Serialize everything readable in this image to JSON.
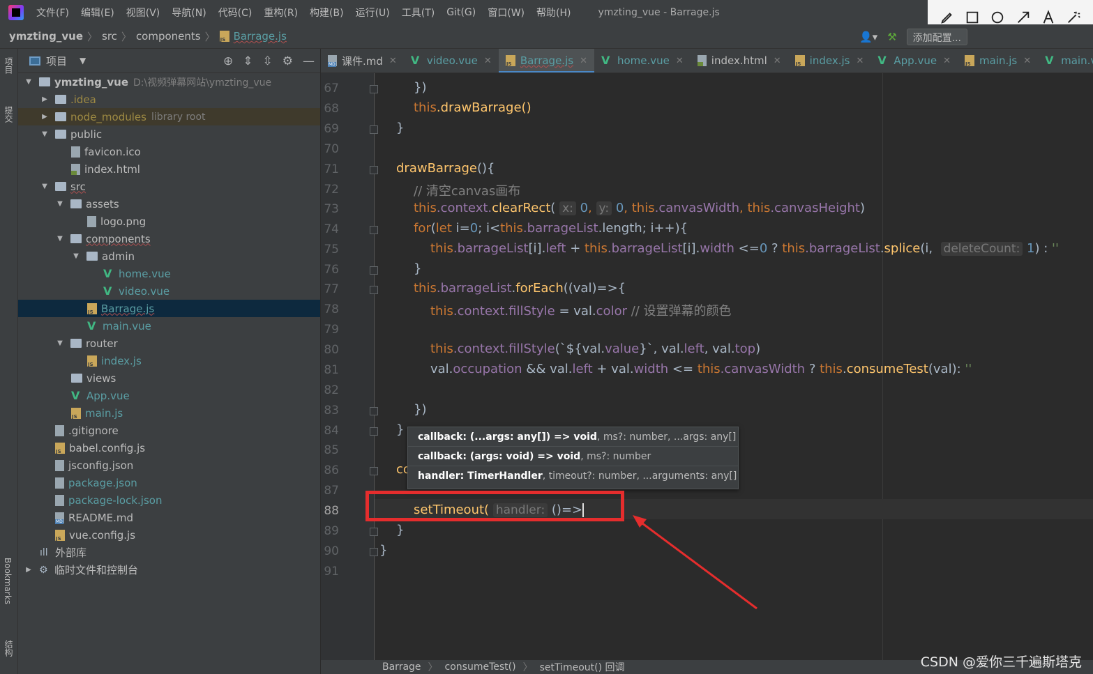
{
  "menu": {
    "items": [
      "文件(F)",
      "编辑(E)",
      "视图(V)",
      "导航(N)",
      "代码(C)",
      "重构(R)",
      "构建(B)",
      "运行(U)",
      "工具(T)",
      "Git(G)",
      "窗口(W)",
      "帮助(H)"
    ],
    "window_title": "ymzting_vue - Barrage.js"
  },
  "navbar": {
    "crumbs": [
      "ymzting_vue",
      "src",
      "components",
      "Barrage.js"
    ],
    "add_config": "添加配置..."
  },
  "left_strip": {
    "project": "项目",
    "commit": "提交",
    "bookmarks": "Bookmarks",
    "structure": "结构"
  },
  "project_panel": {
    "title": "项目",
    "tree": [
      {
        "name": "ymzting_vue",
        "path": "D:\\视频弹幕网站\\ymzting_vue"
      },
      {
        "name": ".idea"
      },
      {
        "name": "node_modules",
        "path": "library root"
      },
      {
        "name": "public"
      },
      {
        "name": "favicon.ico"
      },
      {
        "name": "index.html"
      },
      {
        "name": "src"
      },
      {
        "name": "assets"
      },
      {
        "name": "logo.png"
      },
      {
        "name": "components"
      },
      {
        "name": "admin"
      },
      {
        "name": "home.vue"
      },
      {
        "name": "video.vue"
      },
      {
        "name": "Barrage.js"
      },
      {
        "name": "main.vue"
      },
      {
        "name": "router"
      },
      {
        "name": "index.js"
      },
      {
        "name": "views"
      },
      {
        "name": "App.vue"
      },
      {
        "name": "main.js"
      },
      {
        "name": ".gitignore"
      },
      {
        "name": "babel.config.js"
      },
      {
        "name": "jsconfig.json"
      },
      {
        "name": "package.json"
      },
      {
        "name": "package-lock.json"
      },
      {
        "name": "README.md"
      },
      {
        "name": "vue.config.js"
      },
      {
        "name": "外部库"
      },
      {
        "name": "临时文件和控制台"
      }
    ]
  },
  "tabs": [
    "课件.md",
    "video.vue",
    "Barrage.js",
    "home.vue",
    "index.html",
    "index.js",
    "App.vue",
    "main.js",
    "main.vue"
  ],
  "editor": {
    "line_numbers": [
      "67",
      "68",
      "69",
      "70",
      "71",
      "72",
      "73",
      "74",
      "75",
      "76",
      "77",
      "78",
      "79",
      "80",
      "81",
      "82",
      "83",
      "84",
      "85",
      "86",
      "87",
      "88",
      "89",
      "90",
      "91"
    ],
    "code": {
      "l67": "})",
      "l68a": "this",
      "l68b": ".drawBarrage()",
      "l69": "}",
      "l71": "drawBarrage",
      "l71b": "(){",
      "l72": "// 清空canvas画布",
      "l73a": "this",
      "l73b": ".context.",
      "l73c": "clearRect",
      "l73d": "(",
      "l73hx": "x:",
      "l73e": "0",
      "l73f": ",",
      "l73hy": "y:",
      "l73g": "0",
      "l73h": ",",
      "l73i": "this",
      "l73j": ".canvasWidth",
      "l73k": ",",
      "l73l": "this",
      "l73m": ".canvasHeight",
      "l73n": ")",
      "l74a": "for",
      "l74b": "(",
      "l74c": "let",
      "l74d": " i=",
      "l74e": "0",
      "l74f": "; i<",
      "l74g": "this",
      "l74h": ".barrageList",
      "l74i": ".length; i++){",
      "l75a": "this",
      "l75b": ".barrageList",
      "l75c": "[i].",
      "l75d": "left",
      "l75e": " + ",
      "l75f": "this",
      "l75g": ".barrageList",
      "l75h": "[i].",
      "l75i": "width",
      "l75j": " <=",
      "l75k": "0",
      "l75l": " ? ",
      "l75m": "this",
      "l75n": ".barrageList",
      "l75o": ".",
      "l75p": "splice",
      "l75q": "(i, ",
      "l75hint": "deleteCount:",
      "l75r": "1",
      "l75s": ") : ",
      "l75t": "''",
      "l76": "}",
      "l77a": "this",
      "l77b": ".barrageList",
      "l77c": ".",
      "l77d": "forEach",
      "l77e": "((val)=>{",
      "l78a": "this",
      "l78b": ".context.",
      "l78c": "fillStyle",
      "l78d": " = val.",
      "l78e": "color",
      "l78f": " // 设置弹幕的颜色",
      "l80a": "this",
      "l80b": ".context.",
      "l80c": "fillStyle",
      "l80d": "(`${val.",
      "l80e": "value",
      "l80f": "}`, val.",
      "l80g": "left",
      "l80h": ", val.",
      "l80i": "top",
      "l80j": ")",
      "l81a": "val.",
      "l81b": "occupation",
      "l81c": " && val.",
      "l81d": "left",
      "l81e": " + val.",
      "l81f": "width",
      "l81g": " <= ",
      "l81h": "this",
      "l81i": ".canvasWidth",
      "l81j": " ? ",
      "l81k": "this",
      "l81l": ".",
      "l81m": "consumeTest",
      "l81n": "(val): ",
      "l81o": "''",
      "l83": "})",
      "l84": "}",
      "l86": "co",
      "l88a": "setTimeout",
      "l88b": "(",
      "l88hint": "handler:",
      "l88c": " ()=>",
      "l89": "}",
      "l90": "}"
    }
  },
  "param_popup": [
    {
      "sig": "callback: (...args: any[]) => void",
      "rest": ", ms?: number, ...args: any[]"
    },
    {
      "sig": "callback: (args: void) => void",
      "rest": ", ms?: number"
    },
    {
      "sig": "handler: TimerHandler",
      "rest": ", timeout?: number, ...arguments: any[]"
    }
  ],
  "status_crumbs": [
    "Barrage",
    "consumeTest()",
    "setTimeout() 回调"
  ],
  "watermark": "CSDN @爱你三千遍斯塔克",
  "colors": {
    "keyword": "#cc7832",
    "function": "#ffc66d",
    "property": "#9876aa",
    "number": "#6897bb",
    "annotation": "#e52d2d"
  }
}
